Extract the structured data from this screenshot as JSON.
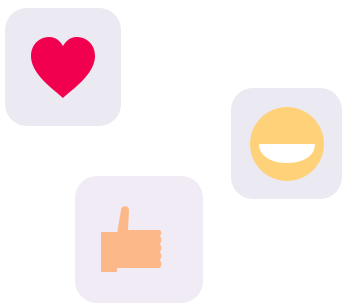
{
  "reactions": [
    {
      "icon": "heart-icon",
      "tile_color": "#EBE9F2",
      "icon_color": "#F1004F"
    },
    {
      "icon": "smile-icon",
      "tile_color": "#EBE9F2",
      "icon_color": "#FFD27A",
      "accent_color": "#FFFFFF"
    },
    {
      "icon": "thumbs-up-icon",
      "tile_color": "#F0EBF4",
      "icon_color": "#FDB88A"
    }
  ]
}
